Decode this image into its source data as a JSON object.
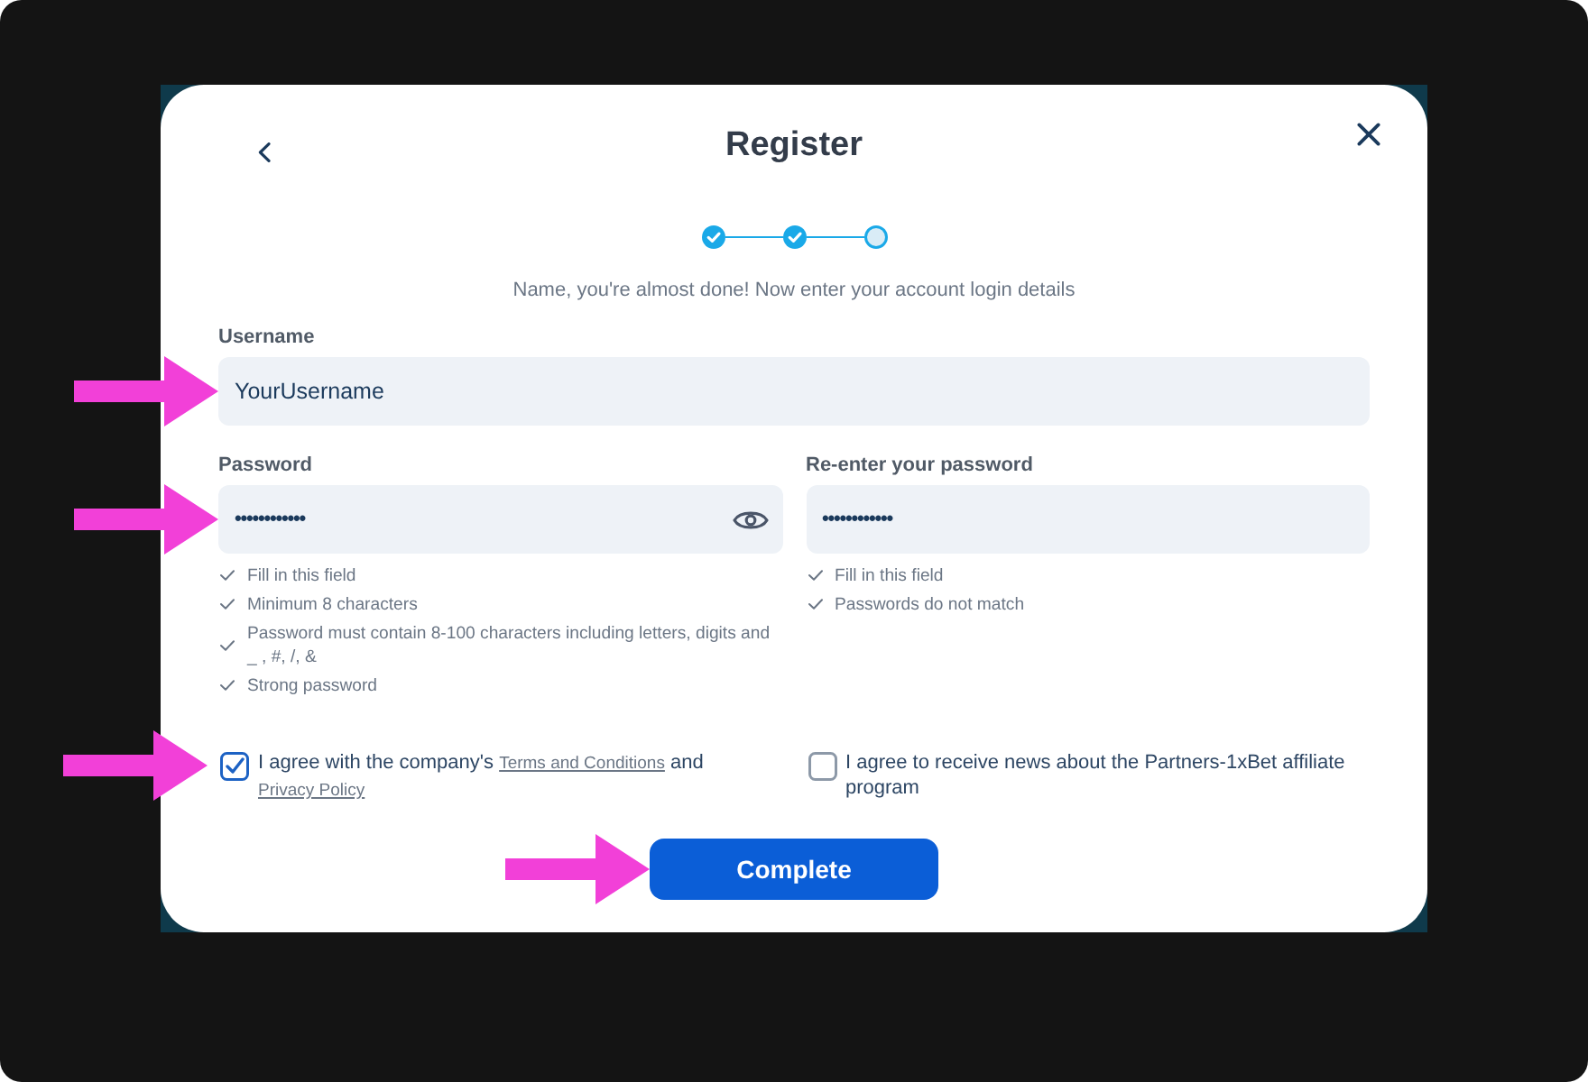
{
  "dialog": {
    "title": "Register"
  },
  "stepper": {
    "steps": [
      {
        "done": true
      },
      {
        "done": true
      },
      {
        "done": false
      }
    ]
  },
  "subtitle": "Name, you're almost done! Now enter your account login details",
  "username": {
    "label": "Username",
    "value": "YourUsername",
    "highlighted": true
  },
  "password_fields": [
    {
      "label": "Password",
      "value": "••••••••••••",
      "highlighted": true,
      "reveal_toggle": true,
      "hints": [
        "Fill in this field",
        "Minimum 8 characters",
        "Password must contain 8-100 characters including letters, digits and _ , #, /, &",
        "Strong password"
      ]
    },
    {
      "label": "Re-enter your password",
      "value": "••••••••••••",
      "highlighted": false,
      "reveal_toggle": false,
      "hints": [
        "Fill in this field",
        "Passwords do not match"
      ]
    }
  ],
  "consents": [
    {
      "checked": true,
      "highlighted": true,
      "parts": [
        {
          "kind": "text",
          "text": "I agree with the company's "
        },
        {
          "kind": "link",
          "text": "Terms and Conditions"
        },
        {
          "kind": "text",
          "text": " and "
        },
        {
          "kind": "link",
          "text": "Privacy Policy"
        }
      ]
    },
    {
      "checked": false,
      "highlighted": false,
      "parts": [
        {
          "kind": "text",
          "text": "I agree to receive news about the Partners-1xBet affiliate program"
        }
      ]
    }
  ],
  "submit": {
    "label": "Complete",
    "highlighted": true
  }
}
